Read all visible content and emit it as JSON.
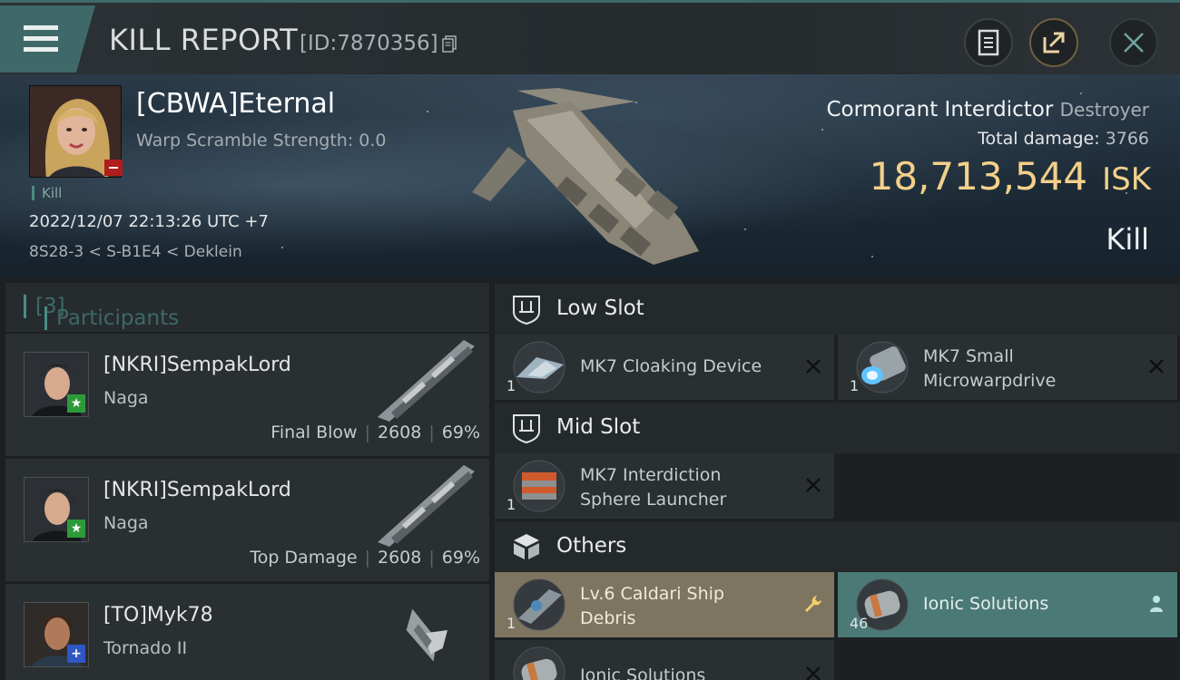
{
  "header": {
    "title": "KILL REPORT",
    "report_id": "[ID:7870356]"
  },
  "victim": {
    "name": "[CBWA]Eternal",
    "scramble_text": "Warp Scramble Strength: 0.0",
    "kill_tag": "Kill",
    "datetime": "2022/12/07 22:13:26 UTC +7",
    "location": "8S28-3 < S-B1E4 < Deklein",
    "ship_name": "Cormorant Interdictor",
    "ship_class": "Destroyer",
    "total_damage_label": "Total damage:",
    "total_damage_value": "3766",
    "isk_value": "18,713,544",
    "isk_unit": "ISK",
    "result": "Kill"
  },
  "participants": {
    "title": "Participants",
    "count": "[3]",
    "items": [
      {
        "name": "[NKRI]SempakLord",
        "ship": "Naga",
        "role": "Final Blow",
        "damage": "2608",
        "percent": "69%",
        "badge": "★",
        "badge_color": "#2d9a3a"
      },
      {
        "name": "[NKRI]SempakLord",
        "ship": "Naga",
        "role": "Top Damage",
        "damage": "2608",
        "percent": "69%",
        "badge": "★",
        "badge_color": "#2d9a3a"
      },
      {
        "name": "[TO]Myk78",
        "ship": "Tornado II",
        "badge": "+",
        "badge_color": "#2f56c4"
      }
    ]
  },
  "slots": {
    "low": {
      "label": "Low Slot",
      "modules": [
        {
          "name": "MK7 Cloaking Device",
          "qty": "1"
        },
        {
          "name_line1": "MK7 Small",
          "name_line2": "Microwarpdrive",
          "qty": "1"
        }
      ]
    },
    "mid": {
      "label": "Mid Slot",
      "modules": [
        {
          "name_line1": "MK7 Interdiction",
          "name_line2": "Sphere Launcher",
          "qty": "1"
        }
      ]
    },
    "others": {
      "label": "Others",
      "modules": [
        {
          "name_line1": "Lv.6 Caldari Ship",
          "name_line2": "Debris",
          "qty": "1"
        },
        {
          "name": "Ionic Solutions",
          "qty": "46"
        },
        {
          "name": "Ionic Solutions"
        }
      ]
    }
  },
  "colors": {
    "accent_teal": "#3f6968",
    "isk_gold": "#f3d08a",
    "loss_badge": "#b01d1d"
  }
}
